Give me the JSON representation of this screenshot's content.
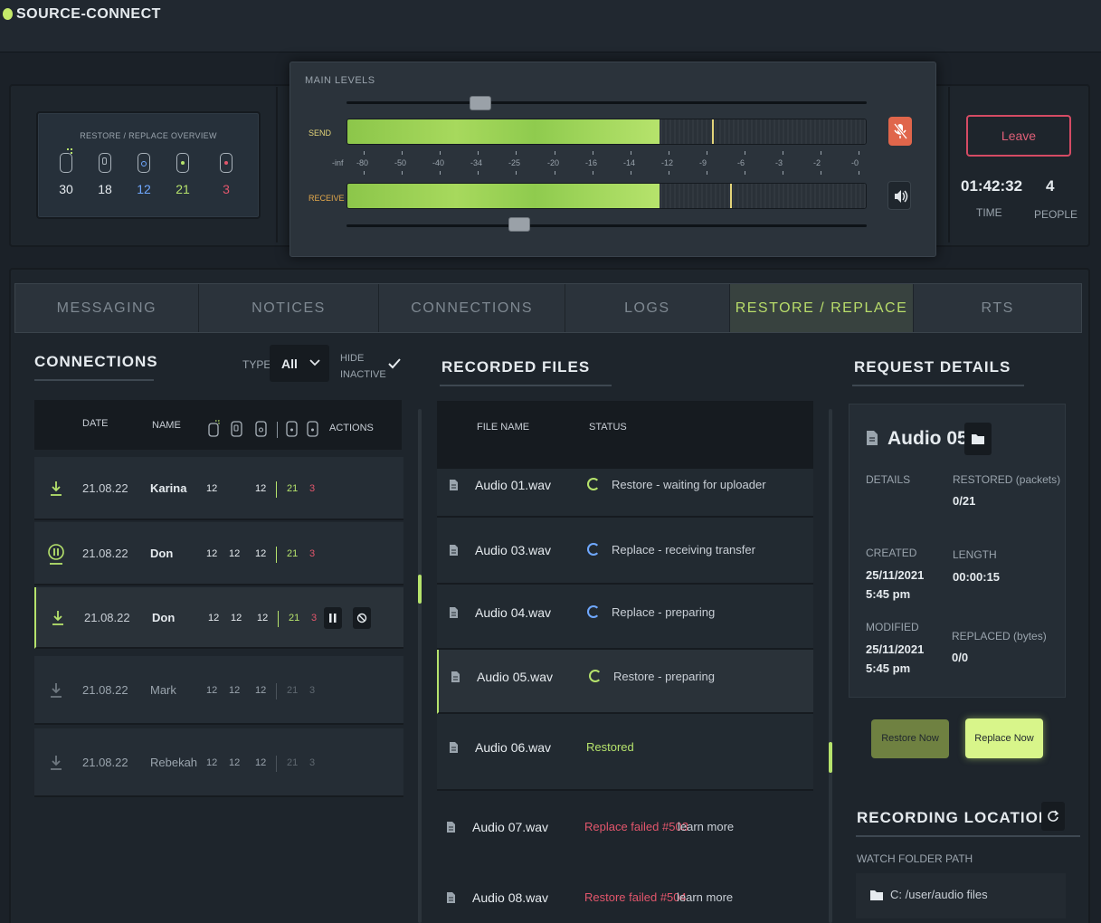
{
  "app": {
    "title": "SOURCE-CONNECT"
  },
  "overview": {
    "title": "RESTORE / REPLACE OVERVIEW",
    "items": [
      {
        "icon": "uploading-file-icon",
        "value": "30",
        "color": "#e6ebef"
      },
      {
        "icon": "file-locked-icon",
        "value": "18",
        "color": "#e6ebef"
      },
      {
        "icon": "file-replace-icon",
        "value": "12",
        "color": "#6fa8ff"
      },
      {
        "icon": "file-restored-icon",
        "value": "21",
        "color": "#b6e36c"
      },
      {
        "icon": "file-failed-icon",
        "value": "3",
        "color": "#e2566c"
      }
    ]
  },
  "levels": {
    "title": "MAIN LEVELS",
    "send_label": "SEND",
    "receive_label": "RECEIVE",
    "scale": [
      "-inf",
      "-80",
      "-50",
      "-40",
      "-34",
      "-25",
      "-20",
      "-16",
      "-14",
      "-12",
      "-9",
      "-6",
      "-3",
      "-2",
      "-0"
    ],
    "send_fill": 0.6,
    "receive_fill": 0.6,
    "send_peak": 0.7,
    "receive_peak": 0.735
  },
  "session": {
    "leave_label": "Leave",
    "time": "01:42:32",
    "time_label": "TIME",
    "people": "4",
    "people_label": "PEOPLE"
  },
  "tabs": [
    {
      "label": "MESSAGING",
      "active": false
    },
    {
      "label": "NOTICES",
      "active": false
    },
    {
      "label": "CONNECTIONS",
      "active": false
    },
    {
      "label": "LOGS",
      "active": false
    },
    {
      "label": "RESTORE / REPLACE",
      "active": true
    },
    {
      "label": "RTS",
      "active": false
    }
  ],
  "connections": {
    "title": "CONNECTIONS",
    "type_label": "TYPE",
    "type_value": "All",
    "hide_inactive_label_1": "HIDE",
    "hide_inactive_label_2": "INACTIVE",
    "columns": {
      "date": "DATE",
      "name": "NAME",
      "actions": "ACTIONS"
    },
    "rows": [
      {
        "date": "21.08.22",
        "name": "Karina",
        "n1": "12",
        "n2": "",
        "n3": "12",
        "n4": "21",
        "n5": "3",
        "state": "download",
        "dim": false
      },
      {
        "date": "21.08.22",
        "name": "Don",
        "n1": "12",
        "n2": "12",
        "n3": "12",
        "n4": "21",
        "n5": "3",
        "state": "paused",
        "dim": false
      },
      {
        "date": "21.08.22",
        "name": "Don",
        "n1": "12",
        "n2": "12",
        "n3": "12",
        "n4": "21",
        "n5": "3",
        "state": "download",
        "dim": false
      },
      {
        "date": "21.08.22",
        "name": "Mark",
        "n1": "12",
        "n2": "12",
        "n3": "12",
        "n4": "21",
        "n5": "3",
        "state": "download",
        "dim": true
      },
      {
        "date": "21.08.22",
        "name": "Rebekah",
        "n1": "12",
        "n2": "12",
        "n3": "12",
        "n4": "21",
        "n5": "3",
        "state": "download",
        "dim": true
      }
    ]
  },
  "files": {
    "title": "RECORDED FILES",
    "col_name": "FILE NAME",
    "col_status": "STATUS",
    "rows": [
      {
        "name": "Audio 01.wav",
        "status": "Restore - waiting for uploader",
        "ring": "#b6e36c",
        "kind": "progress"
      },
      {
        "name": "Audio 03.wav",
        "status": "Replace - receiving transfer",
        "ring": "#6fa8ff",
        "kind": "progress"
      },
      {
        "name": "Audio 04.wav",
        "status": "Replace - preparing",
        "ring": "#6fa8ff",
        "kind": "progress"
      },
      {
        "name": "Audio 05.wav",
        "status": "Restore - preparing",
        "ring": "#b6e36c",
        "kind": "progress"
      },
      {
        "name": "Audio 06.wav",
        "status": "Restored",
        "kind": "restored"
      },
      {
        "name": "Audio 07.wav",
        "status": "Replace failed #503",
        "more": "learn more",
        "kind": "failed"
      },
      {
        "name": "Audio 08.wav",
        "status": "Restore failed #504",
        "more": "learn more",
        "kind": "failed"
      }
    ]
  },
  "details": {
    "title": "REQUEST DETAILS",
    "file_title": "Audio 05",
    "details_label": "DETAILS",
    "restored_label": "RESTORED (packets)",
    "restored_value": "0/21",
    "created_label": "CREATED",
    "created_date": "25/11/2021",
    "created_time": "5:45 pm",
    "length_label": "LENGTH",
    "length_value": "00:00:15",
    "modified_label": "MODIFIED",
    "modified_date": "25/11/2021",
    "modified_time": "5:45 pm",
    "replaced_label": "REPLACED (bytes)",
    "replaced_value": "0/0",
    "restore_btn": "Restore Now",
    "replace_btn": "Replace Now"
  },
  "recording": {
    "title": "RECORDING LOCATION",
    "watch_label": "WATCH FOLDER PATH",
    "path": "C: /user/audio files"
  }
}
